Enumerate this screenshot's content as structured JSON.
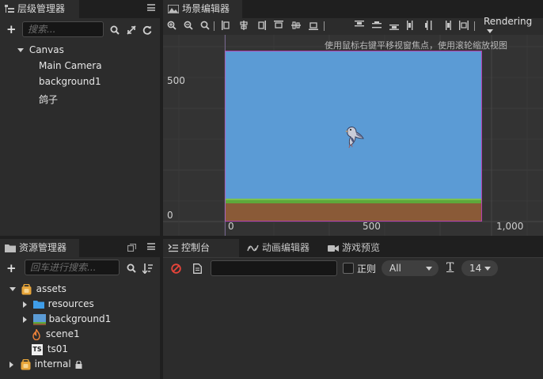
{
  "hierarchy": {
    "title": "层级管理器",
    "search_placeholder": "搜索...",
    "nodes": [
      {
        "label": "Canvas"
      },
      {
        "label": "Main Camera"
      },
      {
        "label": "background1"
      },
      {
        "label": "鸽子"
      }
    ]
  },
  "scene": {
    "title": "场景编辑器",
    "rendering_label": "Rendering",
    "hint": "使用鼠标右键平移视窗焦点，使用滚轮缩放视图",
    "axis_labels": {
      "y_500": "500",
      "y_0": "0",
      "x_0": "0",
      "x_500": "500",
      "x_1000": "1,000"
    }
  },
  "assets": {
    "title": "资源管理器",
    "search_placeholder": "回车进行搜索...",
    "items": [
      {
        "label": "assets"
      },
      {
        "label": "resources"
      },
      {
        "label": "background1"
      },
      {
        "label": "scene1"
      },
      {
        "label": "ts01"
      },
      {
        "label": "internal"
      }
    ],
    "ts_badge": "TS"
  },
  "console": {
    "tabs": [
      {
        "label": "控制台"
      },
      {
        "label": "动画编辑器"
      },
      {
        "label": "游戏预览"
      }
    ],
    "regex_label": "正则",
    "level_select": "All",
    "font_size": "14",
    "font_icon_glyph": "T"
  },
  "colors": {
    "sky": "#5b9bd5",
    "grass": "#5ea83b",
    "dirt": "#8a5a37",
    "canvas_border": "#b43fb0",
    "accent_red": "#e8443a"
  }
}
